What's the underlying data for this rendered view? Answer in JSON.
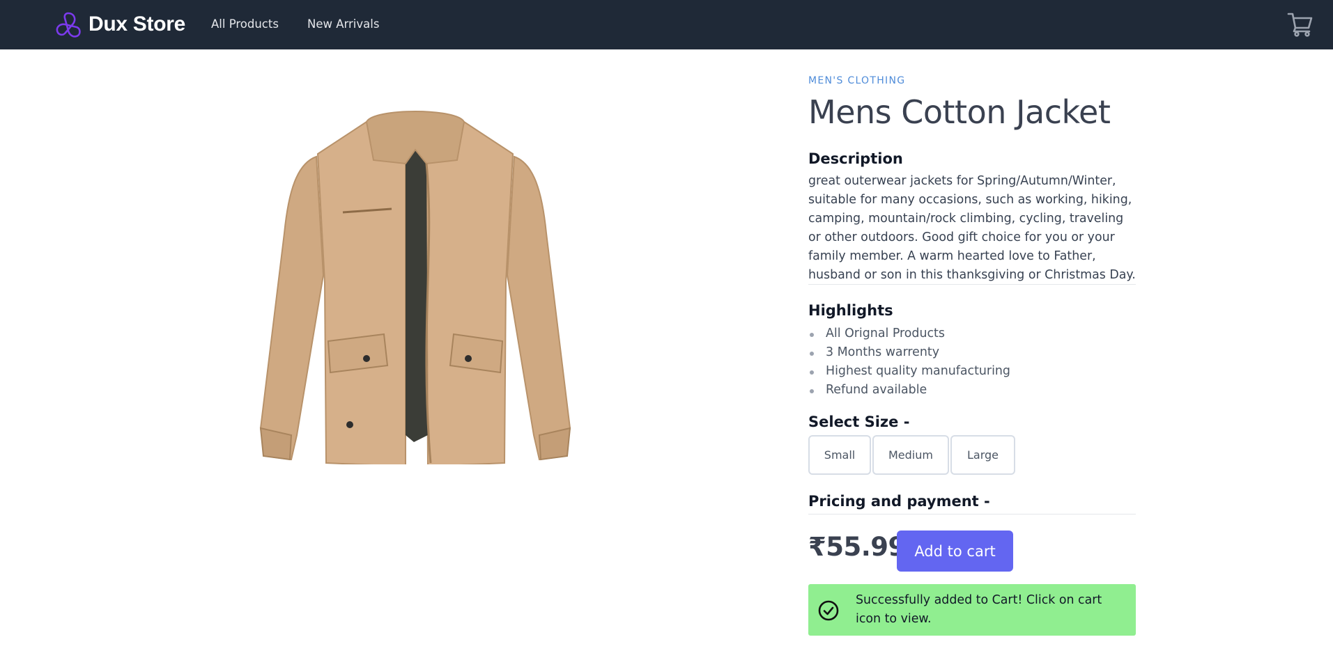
{
  "brand": {
    "name": "Dux Store",
    "logo_icon": "knot-logo-icon",
    "logo_color": "#7c3aed"
  },
  "nav": {
    "links": [
      {
        "label": "All Products"
      },
      {
        "label": "New Arrivals"
      }
    ],
    "cart_icon": "cart-icon"
  },
  "product": {
    "category": "MEN'S CLOTHING",
    "title": "Mens Cotton Jacket",
    "image_alt": "jacket-image",
    "description_heading": "Description",
    "description": "great outerwear jackets for Spring/Autumn/Winter, suitable for many occasions, such as working, hiking, camping, mountain/rock climbing, cycling, traveling or other outdoors. Good gift choice for you or your family member. A warm hearted love to Father, husband or son in this thanksgiving or Christmas Day.",
    "highlights_heading": "Highlights",
    "highlights": [
      "All Orignal Products",
      "3 Months warrenty",
      "Highest quality manufacturing",
      "Refund available"
    ],
    "size_heading": "Select Size -",
    "sizes": [
      "Small",
      "Medium",
      "Large"
    ],
    "pricing_heading": "Pricing and payment -",
    "price": "₹55.99",
    "add_to_cart_label": "Add to cart"
  },
  "toast": {
    "message": "Successfully added to Cart! Click on cart icon to view.",
    "icon": "check-circle-icon",
    "color": "#90ee90"
  },
  "colors": {
    "navbar": "#1f2937",
    "accent": "#6366f1",
    "category": "#4f8cd9"
  }
}
